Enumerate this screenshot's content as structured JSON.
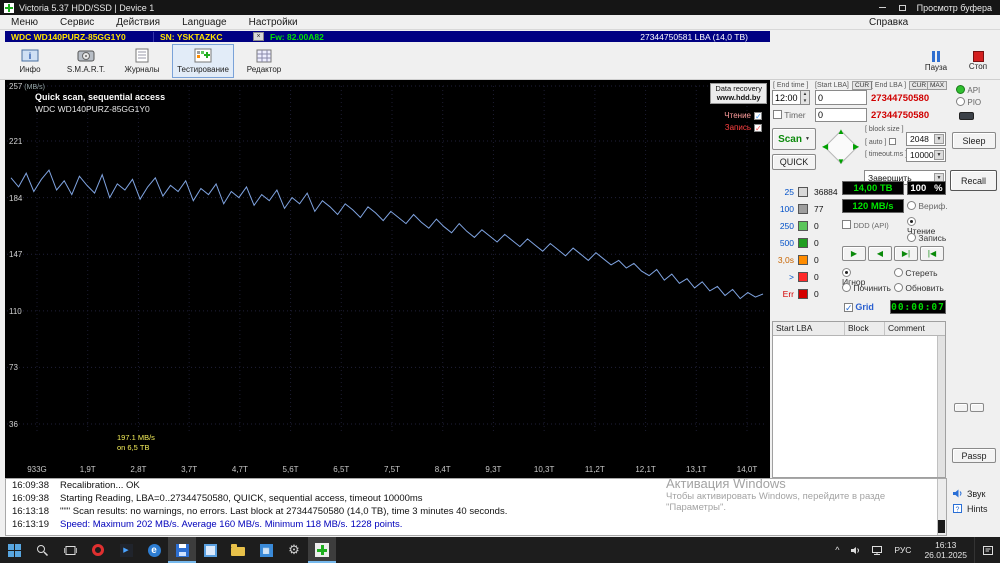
{
  "titlebar": {
    "title": "Victoria 5.37 HDD/SSD | Device 1",
    "buffer_label": "Просмотр буфера"
  },
  "menubar": {
    "items": [
      "Меню",
      "Сервис",
      "Действия",
      "Language",
      "Настройки"
    ],
    "help": "Справка"
  },
  "device_bar": {
    "model": "WDC WD140PURZ-85GG1Y0",
    "serial": "SN: YSKTAZKC",
    "firmware": "Fw: 82.00A82",
    "lba": "27344750581 LBA (14,0 ТВ)"
  },
  "toolbar": {
    "buttons": [
      {
        "label": "Инфо",
        "icon": "info-icon"
      },
      {
        "label": "S.M.A.R.T.",
        "icon": "smart-icon"
      },
      {
        "label": "Журналы",
        "icon": "logs-icon"
      },
      {
        "label": "Тестирование",
        "icon": "test-icon"
      },
      {
        "label": "Редактор",
        "icon": "editor-icon"
      }
    ],
    "pause_label": "Пауза",
    "stop_label": "Стоп"
  },
  "graph": {
    "title_line1": "Quick scan, sequential access",
    "title_line2": "WDC WD140PURZ-85GG1Y0",
    "watermark_line1": "Data recovery",
    "watermark_line2": "www.hdd.by",
    "legend_read": "Чтение",
    "legend_write": "Запись",
    "annotation_line1": "197.1 MB/s",
    "annotation_line2": "on 6,5 ТВ"
  },
  "chart_data": {
    "type": "line",
    "title": "Quick scan, sequential access",
    "ylabel": "MB/s",
    "y_unit": "(MB/s)",
    "ylim": [
      36,
      257
    ],
    "y_ticks": [
      257,
      221,
      184,
      147,
      110,
      73,
      36
    ],
    "x_ticks": [
      "933G",
      "1,9T",
      "2,8T",
      "3,7T",
      "4,7T",
      "5,6T",
      "6,5T",
      "7,5T",
      "8,4T",
      "9,3T",
      "10,3T",
      "11,2T",
      "12,1T",
      "13,1T",
      "14,0T"
    ],
    "series": [
      {
        "name": "Чтение",
        "color": "#7fa3e0",
        "values": [
          197,
          191,
          200,
          188,
          196,
          202,
          189,
          195,
          186,
          198,
          192,
          187,
          199,
          184,
          193,
          189,
          196,
          183,
          191,
          197,
          185,
          192,
          188,
          195,
          182,
          190,
          186,
          193,
          180,
          188,
          184,
          191,
          179,
          186,
          182,
          189,
          177,
          184,
          180,
          187,
          175,
          182,
          178,
          173,
          180,
          176,
          171,
          178,
          174,
          169,
          175,
          171,
          167,
          173,
          168,
          164,
          170,
          165,
          161,
          167,
          162,
          158,
          163,
          159,
          155,
          160,
          156,
          152,
          157,
          153,
          149,
          154,
          150,
          146,
          151,
          147,
          143,
          148,
          144,
          140,
          143,
          138,
          141,
          136,
          133,
          137,
          130,
          134,
          128,
          131,
          125,
          129,
          123,
          126,
          120,
          124,
          118,
          122,
          119,
          121
        ]
      }
    ]
  },
  "panel": {
    "end_time_label": "[ End time ]",
    "end_time_value": "12:00",
    "start_lba_label": "[Start LBA]",
    "cur_label": "CUR",
    "max_label": "MAX",
    "start_lba_value": "0",
    "end_lba_label": "[ End LBA ]",
    "end_lba_value": "27344750580",
    "timer_label": "Timer",
    "timer_value": "0",
    "block_size_label": "[ block size ]",
    "auto_label": "[ auto ]",
    "block_size_value": "2048",
    "timeout_label": "[ timeout.ms ]",
    "timeout_value": "10000",
    "scan_label": "Scan",
    "quick_label": "QUICK",
    "action_value": "Завершить",
    "buckets": [
      {
        "label": "25",
        "count": "36884",
        "color": "#d9d9d9",
        "label_color": "#0050c8"
      },
      {
        "label": "100",
        "count": "77",
        "color": "#9e9e9e",
        "label_color": "#0050c8"
      },
      {
        "label": "250",
        "count": "0",
        "color": "#5cc65c",
        "label_color": "#0050c8"
      },
      {
        "label": "500",
        "count": "0",
        "color": "#219e21",
        "label_color": "#0050c8"
      },
      {
        "label": "3,0s",
        "count": "0",
        "color": "#ff8c00",
        "label_color": "#c86400"
      },
      {
        "label": ">",
        "count": "0",
        "color": "#ff2a2a",
        "label_color": "#0050c8"
      },
      {
        "label": "Err",
        "count": "0",
        "color": "#d40000",
        "label_color": "#d40000"
      }
    ],
    "size_display": "14,00 ТВ",
    "percent_display": "100   %",
    "speed_display": "120 MB/s",
    "verify_label": "Вериф.",
    "read_label": "Чтение",
    "write_label": "Запись",
    "ddd_label": "DDD (API)",
    "remap_options": [
      "Игнор",
      "Стереть",
      "Починить",
      "Обновить"
    ],
    "grid_label": "Grid",
    "elapsed_display": "00:00:07",
    "table_headers": [
      "Start LBA",
      "Block",
      "Comment"
    ]
  },
  "right_edge": {
    "api_label": "API",
    "pio_label": "PIO",
    "sleep_label": "Sleep",
    "recall_label": "Recall",
    "passp_label": "Passp",
    "sound_label": "Звук",
    "hints_label": "Hints"
  },
  "log": {
    "lines": [
      {
        "time": "16:09:38",
        "text": "Recalibration... OK",
        "color": "#111111"
      },
      {
        "time": "16:09:38",
        "text": "Starting Reading, LBA=0..27344750580, QUICK, sequential access, timeout 10000ms",
        "color": "#111111"
      },
      {
        "time": "16:13:18",
        "text": "\"\"\" Scan results: no warnings, no errors. Last block at 27344750580 (14,0 ТВ), time 3 minutes 40 seconds.",
        "color": "#111111"
      },
      {
        "time": "16:13:19",
        "text": "Speed: Maximum 202 MB/s. Average 160 MB/s. Minimum 118 MB/s. 1228 points.",
        "color": "#0000bb"
      }
    ]
  },
  "watermark": {
    "line1": "Активация Windows",
    "line2": "Чтобы активировать Windows, перейдите в разде",
    "line3": "\"Параметры\"."
  },
  "taskbar": {
    "icons": [
      "start",
      "search",
      "task-view",
      "opera",
      "media-player",
      "browser",
      "save-tool",
      "window-app",
      "folder",
      "blue-app",
      "settings-gear",
      "victoria",
      "tray-expand",
      "volume",
      "network",
      "language",
      "clock",
      "action-center"
    ],
    "lang": "РУС",
    "time": "16:13",
    "date": "26.01.2025"
  },
  "icons": {
    "dropdown": "▼",
    "spin_up": "▲",
    "spin_down": "▼",
    "check": "✓",
    "play": "▶",
    "rewind": "◀",
    "forward": "▶|",
    "restart": "|◀"
  }
}
